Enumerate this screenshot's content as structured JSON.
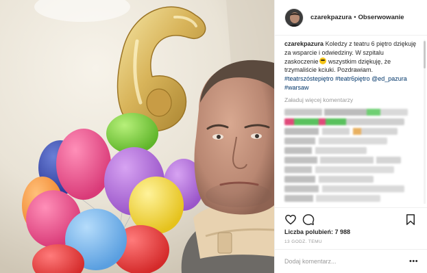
{
  "post": {
    "username": "czarekpazura",
    "dot": "•",
    "follow_label": "Obserwowanie",
    "caption": {
      "username": "czarekpazura",
      "text_1": "Koledzy z teatru 6 piętro dziękuję za wsparcie i odwiedziny. W szpitalu zaskoczenie",
      "emoji": "sunglasses-face-emoji",
      "text_2": "wszystkim dziękuję, że trzymaliście kciuki. Pozdrawiam.",
      "hashtag_1": "#teatrszóstepiętro",
      "hashtag_2": "#teatr6piętro",
      "mention": "@ed_pazura",
      "hashtag_3": "#warsaw"
    },
    "load_more_label": "Załaduj więcej komentarzy",
    "likes_label": "Liczba polubień:",
    "likes_count": "7 988",
    "time_ago": "13 GODZ. TEMU",
    "add_comment_placeholder": "Dodaj komentarz...",
    "more_label": "•••"
  },
  "icons": {
    "like": "heart-outline-icon",
    "comment": "comment-bubble-icon",
    "save": "bookmark-icon"
  },
  "colors": {
    "text": "#262626",
    "muted": "#999999",
    "link": "#003569",
    "border": "#efefef"
  }
}
